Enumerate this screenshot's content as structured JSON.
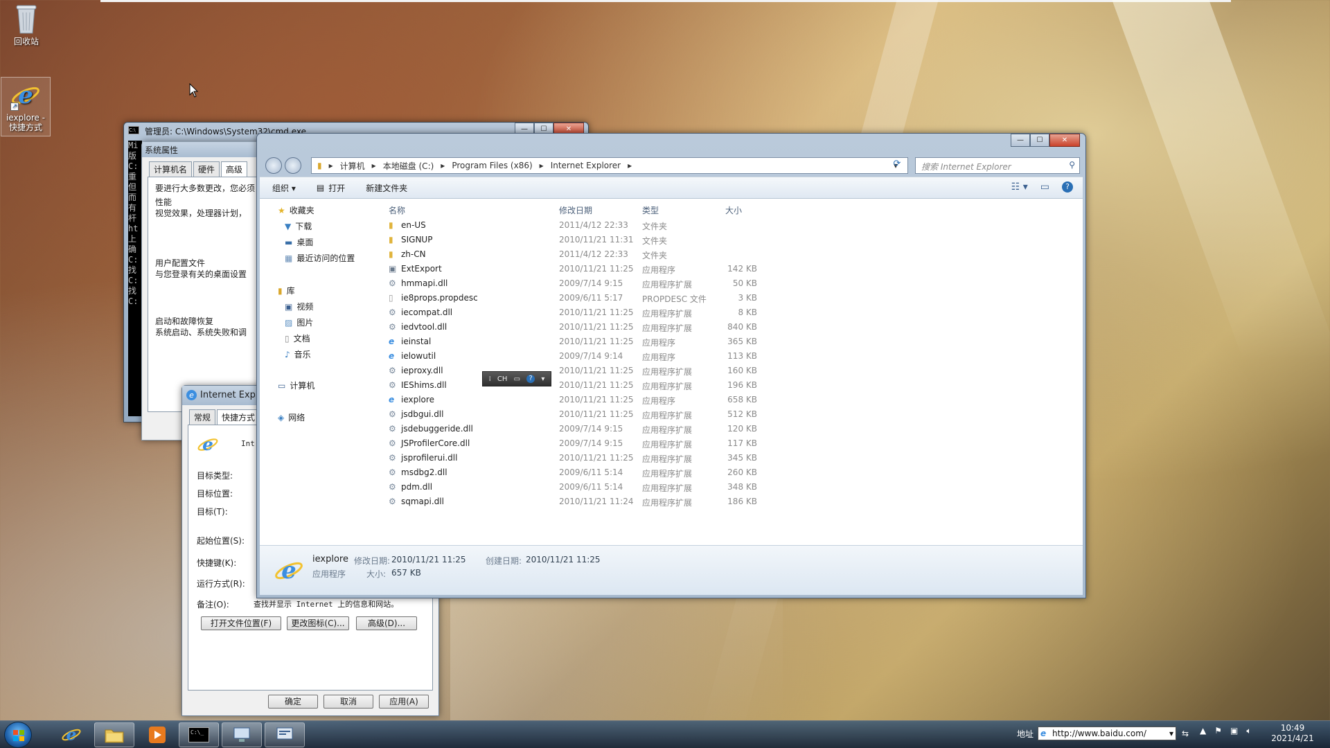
{
  "desktop": {
    "icons": [
      {
        "label": "回收站"
      },
      {
        "label": "iexplore - 快捷方式"
      }
    ]
  },
  "cmd": {
    "title": "管理员: C:\\Windows\\System32\\cmd.exe",
    "lines": [
      "Mi",
      "版",
      "",
      "C:",
      "",
      "重",
      "但",
      "而",
      "有",
      "杆",
      "ht",
      "上",
      "",
      "确",
      "",
      "C:",
      "找",
      "",
      "C:",
      "找",
      "",
      "C:"
    ]
  },
  "sysprop": {
    "title": "系统属性",
    "tabs": [
      "计算机名",
      "硬件",
      "高级"
    ],
    "active_tab": "高级",
    "intro": "要进行大多数更改，您必须",
    "perf_heading": "性能",
    "perf_desc": "视觉效果，处理器计划，",
    "profile_heading": "用户配置文件",
    "profile_desc": "与您登录有关的桌面设置",
    "startup_heading": "启动和故障恢复",
    "startup_desc": "系统启动、系统失败和调"
  },
  "ieprop": {
    "title": "Internet Explo",
    "tabs": [
      "常规",
      "快捷方式"
    ],
    "active_tab": "快捷方式",
    "name_prefix": "Int",
    "rows": {
      "target_type": "目标类型:",
      "target_loc": "目标位置:",
      "target": "目标(T):",
      "start_in": "起始位置(S):",
      "shortcut_key": "快捷键(K):",
      "run": "运行方式(R):",
      "comment_label": "备注(O):",
      "comment_value": "查找并显示 Internet 上的信息和网站。"
    },
    "buttons": {
      "open_location": "打开文件位置(F)",
      "change_icon": "更改图标(C)...",
      "advanced": "高级(D)...",
      "ok": "确定",
      "cancel": "取消",
      "apply": "应用(A)"
    }
  },
  "explorer": {
    "breadcrumb": [
      "计算机",
      "本地磁盘 (C:)",
      "Program Files (x86)",
      "Internet Explorer"
    ],
    "search_placeholder": "搜索 Internet Explorer",
    "toolbar": {
      "organize": "组织 ▾",
      "open": "打开",
      "new_folder": "新建文件夹"
    },
    "nav": {
      "favorites": "收藏夹",
      "downloads": "下载",
      "desktop": "桌面",
      "recent": "最近访问的位置",
      "libraries": "库",
      "videos": "视频",
      "pictures": "图片",
      "documents": "文档",
      "music": "音乐",
      "computer": "计算机",
      "network": "网络"
    },
    "columns": {
      "name": "名称",
      "date": "修改日期",
      "type": "类型",
      "size": "大小"
    },
    "files": [
      {
        "name": "en-US",
        "date": "2011/4/12 22:33",
        "type": "文件夹",
        "size": "",
        "kind": "folder"
      },
      {
        "name": "SIGNUP",
        "date": "2010/11/21 11:31",
        "type": "文件夹",
        "size": "",
        "kind": "folder"
      },
      {
        "name": "zh-CN",
        "date": "2011/4/12 22:33",
        "type": "文件夹",
        "size": "",
        "kind": "folder"
      },
      {
        "name": "ExtExport",
        "date": "2010/11/21 11:25",
        "type": "应用程序",
        "size": "142 KB",
        "kind": "exe"
      },
      {
        "name": "hmmapi.dll",
        "date": "2009/7/14 9:15",
        "type": "应用程序扩展",
        "size": "50 KB",
        "kind": "dll"
      },
      {
        "name": "ie8props.propdesc",
        "date": "2009/6/11 5:17",
        "type": "PROPDESC 文件",
        "size": "3 KB",
        "kind": "file"
      },
      {
        "name": "iecompat.dll",
        "date": "2010/11/21 11:25",
        "type": "应用程序扩展",
        "size": "8 KB",
        "kind": "dll"
      },
      {
        "name": "iedvtool.dll",
        "date": "2010/11/21 11:25",
        "type": "应用程序扩展",
        "size": "840 KB",
        "kind": "dll"
      },
      {
        "name": "ieinstal",
        "date": "2010/11/21 11:25",
        "type": "应用程序",
        "size": "365 KB",
        "kind": "ie"
      },
      {
        "name": "ielowutil",
        "date": "2009/7/14 9:14",
        "type": "应用程序",
        "size": "113 KB",
        "kind": "ie"
      },
      {
        "name": "ieproxy.dll",
        "date": "2010/11/21 11:25",
        "type": "应用程序扩展",
        "size": "160 KB",
        "kind": "dll"
      },
      {
        "name": "IEShims.dll",
        "date": "2010/11/21 11:25",
        "type": "应用程序扩展",
        "size": "196 KB",
        "kind": "dll"
      },
      {
        "name": "iexplore",
        "date": "2010/11/21 11:25",
        "type": "应用程序",
        "size": "658 KB",
        "kind": "ie"
      },
      {
        "name": "jsdbgui.dll",
        "date": "2010/11/21 11:25",
        "type": "应用程序扩展",
        "size": "512 KB",
        "kind": "dll"
      },
      {
        "name": "jsdebuggeride.dll",
        "date": "2009/7/14 9:15",
        "type": "应用程序扩展",
        "size": "120 KB",
        "kind": "dll"
      },
      {
        "name": "JSProfilerCore.dll",
        "date": "2009/7/14 9:15",
        "type": "应用程序扩展",
        "size": "117 KB",
        "kind": "dll"
      },
      {
        "name": "jsprofilerui.dll",
        "date": "2010/11/21 11:25",
        "type": "应用程序扩展",
        "size": "345 KB",
        "kind": "dll"
      },
      {
        "name": "msdbg2.dll",
        "date": "2009/6/11 5:14",
        "type": "应用程序扩展",
        "size": "260 KB",
        "kind": "dll"
      },
      {
        "name": "pdm.dll",
        "date": "2009/6/11 5:14",
        "type": "应用程序扩展",
        "size": "348 KB",
        "kind": "dll"
      },
      {
        "name": "sqmapi.dll",
        "date": "2010/11/21 11:24",
        "type": "应用程序扩展",
        "size": "186 KB",
        "kind": "dll"
      }
    ],
    "details": {
      "name": "iexplore",
      "modified_label": "修改日期:",
      "modified": "2010/11/21 11:25",
      "created_label": "创建日期:",
      "created": "2010/11/21 11:25",
      "type": "应用程序",
      "size_label": "大小:",
      "size": "657 KB"
    }
  },
  "ime": {
    "label": "CH"
  },
  "taskbar": {
    "address_label": "地址",
    "address_value": "http://www.baidu.com/",
    "time": "10:49",
    "date": "2021/4/21"
  }
}
